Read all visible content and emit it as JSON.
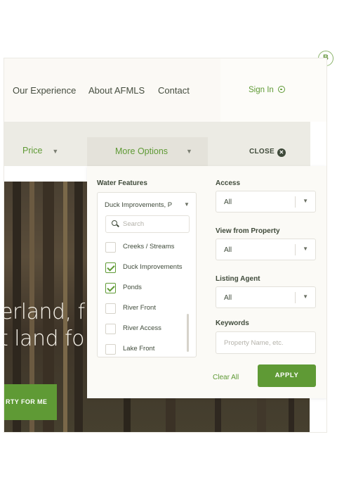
{
  "badge": "B",
  "nav": {
    "links": [
      "Our Experience",
      "About AFMLS",
      "Contact"
    ],
    "sign_in": "Sign In"
  },
  "filters": {
    "price_label": "Price",
    "more_options_label": "More Options",
    "close_label": "CLOSE",
    "caret": "▼"
  },
  "hero": {
    "line1": "erland, f",
    "line2": "t land fo",
    "cta": "RTY FOR ME"
  },
  "panel": {
    "water_features": {
      "label": "Water Features",
      "value": "Duck Improvements, P",
      "search_placeholder": "Search",
      "options": [
        {
          "label": "Creeks / Streams",
          "checked": false
        },
        {
          "label": "Duck Improvements",
          "checked": true
        },
        {
          "label": "Ponds",
          "checked": true
        },
        {
          "label": "River Front",
          "checked": false
        },
        {
          "label": "River Access",
          "checked": false
        },
        {
          "label": "Lake Front",
          "checked": false
        }
      ]
    },
    "access": {
      "label": "Access",
      "value": "All"
    },
    "view_from_property": {
      "label": "View from Property",
      "value": "All"
    },
    "listing_agent": {
      "label": "Listing Agent",
      "value": "All"
    },
    "keywords": {
      "label": "Keywords",
      "placeholder": "Property Name, etc."
    },
    "clear_all": "Clear All",
    "apply": "APPLY"
  },
  "colors": {
    "accent": "#5f9a35",
    "text": "#3f4a3a",
    "filter_bar": "#ecebe4"
  }
}
